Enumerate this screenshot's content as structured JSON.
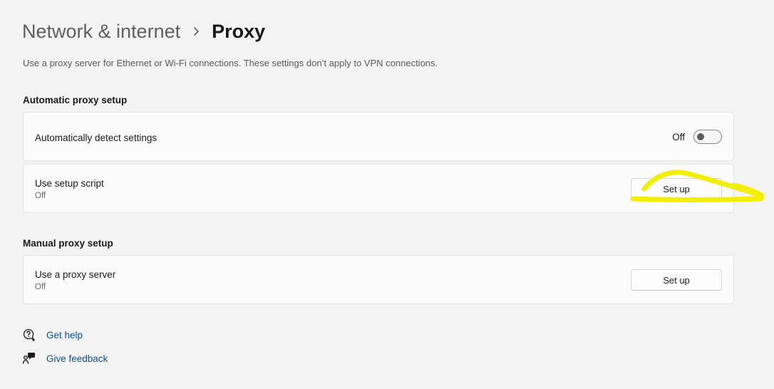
{
  "header": {
    "parent_label": "Network & internet",
    "separator_icon": "chevron-right-icon",
    "current_label": "Proxy"
  },
  "description": "Use a proxy server for Ethernet or Wi-Fi connections. These settings don’t apply to VPN connections.",
  "automatic": {
    "title": "Automatic proxy setup",
    "detect": {
      "label": "Automatically detect settings",
      "state_label": "Off",
      "is_on": false
    },
    "script": {
      "label": "Use setup script",
      "sub": "Off",
      "button_label": "Set up"
    }
  },
  "manual": {
    "title": "Manual proxy setup",
    "server": {
      "label": "Use a proxy server",
      "sub": "Off",
      "button_label": "Set up"
    }
  },
  "links": [
    {
      "icon": "help-icon",
      "label": "Get help"
    },
    {
      "icon": "feedback-icon",
      "label": "Give feedback"
    }
  ],
  "colors": {
    "background": "#f3f3f3",
    "card": "#fbfbfb",
    "link": "#0f4f8c",
    "annotation": "#f2ee05"
  }
}
